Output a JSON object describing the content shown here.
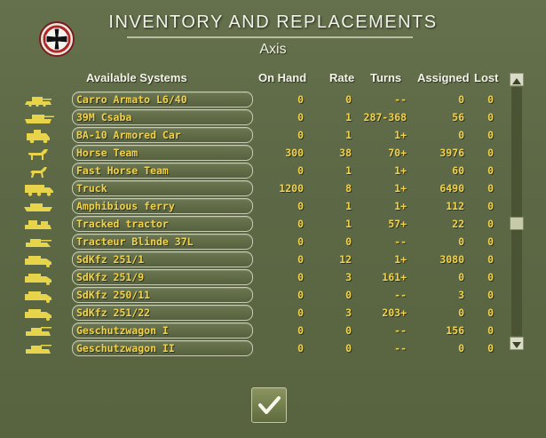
{
  "header": {
    "title": "INVENTORY AND REPLACEMENTS",
    "side": "Axis",
    "emblem_icon": "iron-cross-emblem-icon"
  },
  "columns": {
    "system": "Available Systems",
    "on_hand": "On Hand",
    "rate": "Rate",
    "turns": "Turns",
    "assigned": "Assigned",
    "lost": "Lost"
  },
  "rows": [
    {
      "icon": "light-tank-icon",
      "name": "Carro Armato L6/40",
      "on_hand": "0",
      "rate": "0",
      "turns": "--",
      "assigned": "0",
      "lost": "0"
    },
    {
      "icon": "tank-icon",
      "name": "39M Csaba",
      "on_hand": "0",
      "rate": "1",
      "turns": "287-368",
      "assigned": "56",
      "lost": "0"
    },
    {
      "icon": "armored-car-icon",
      "name": "BA-10 Armored Car",
      "on_hand": "0",
      "rate": "1",
      "turns": "1+",
      "assigned": "0",
      "lost": "0"
    },
    {
      "icon": "horse-team-icon",
      "name": "Horse Team",
      "on_hand": "300",
      "rate": "38",
      "turns": "70+",
      "assigned": "3976",
      "lost": "0"
    },
    {
      "icon": "fast-horse-icon",
      "name": "Fast Horse Team",
      "on_hand": "0",
      "rate": "1",
      "turns": "1+",
      "assigned": "60",
      "lost": "0"
    },
    {
      "icon": "truck-icon",
      "name": "Truck",
      "on_hand": "1200",
      "rate": "8",
      "turns": "1+",
      "assigned": "6490",
      "lost": "0"
    },
    {
      "icon": "amphibious-ferry-icon",
      "name": "Amphibious ferry",
      "on_hand": "0",
      "rate": "1",
      "turns": "1+",
      "assigned": "112",
      "lost": "0"
    },
    {
      "icon": "tracked-tractor-icon",
      "name": "Tracked tractor",
      "on_hand": "0",
      "rate": "1",
      "turns": "57+",
      "assigned": "22",
      "lost": "0"
    },
    {
      "icon": "tracteur-blinde-icon",
      "name": "Tracteur Blinde 37L",
      "on_hand": "0",
      "rate": "0",
      "turns": "--",
      "assigned": "0",
      "lost": "0"
    },
    {
      "icon": "halftrack-icon",
      "name": "SdKfz 251/1",
      "on_hand": "0",
      "rate": "12",
      "turns": "1+",
      "assigned": "3080",
      "lost": "0"
    },
    {
      "icon": "halftrack-icon",
      "name": "SdKfz 251/9",
      "on_hand": "0",
      "rate": "3",
      "turns": "161+",
      "assigned": "0",
      "lost": "0"
    },
    {
      "icon": "halftrack-icon",
      "name": "SdKfz 250/11",
      "on_hand": "0",
      "rate": "0",
      "turns": "--",
      "assigned": "3",
      "lost": "0"
    },
    {
      "icon": "halftrack-icon",
      "name": "SdKfz 251/22",
      "on_hand": "0",
      "rate": "3",
      "turns": "203+",
      "assigned": "0",
      "lost": "0"
    },
    {
      "icon": "self-propelled-gun-icon",
      "name": "Geschutzwagon I",
      "on_hand": "0",
      "rate": "0",
      "turns": "--",
      "assigned": "156",
      "lost": "0"
    },
    {
      "icon": "self-propelled-gun-icon",
      "name": "Geschutzwagon II",
      "on_hand": "0",
      "rate": "0",
      "turns": "--",
      "assigned": "0",
      "lost": "0"
    }
  ],
  "scrollbar": {
    "up_icon": "scroll-up-arrow-icon",
    "down_icon": "scroll-down-arrow-icon",
    "position": 0.55
  },
  "ok_button": {
    "icon": "checkmark-icon"
  },
  "colors": {
    "accent_text": "#f0d24c",
    "panel": "#5e6b47",
    "icon_fill": "#e8d44a"
  }
}
